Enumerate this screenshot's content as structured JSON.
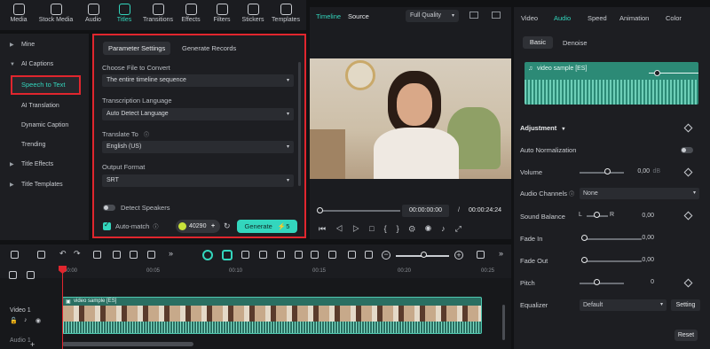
{
  "toolbar": {
    "items": [
      {
        "label": "Media",
        "icon": "media-icon"
      },
      {
        "label": "Stock Media",
        "icon": "stock-media-icon"
      },
      {
        "label": "Audio",
        "icon": "audio-icon"
      },
      {
        "label": "Titles",
        "icon": "titles-icon",
        "active": true
      },
      {
        "label": "Transitions",
        "icon": "transitions-icon"
      },
      {
        "label": "Effects",
        "icon": "effects-icon"
      },
      {
        "label": "Filters",
        "icon": "filters-icon"
      },
      {
        "label": "Stickers",
        "icon": "stickers-icon"
      },
      {
        "label": "Templates",
        "icon": "templates-icon"
      }
    ]
  },
  "sidebar": {
    "items": [
      {
        "label": "Mine"
      },
      {
        "label": "AI Captions"
      },
      {
        "label": "Speech to Text"
      },
      {
        "label": "AI Translation"
      },
      {
        "label": "Dynamic Caption"
      },
      {
        "label": "Trending"
      },
      {
        "label": "Title Effects"
      },
      {
        "label": "Title Templates"
      }
    ]
  },
  "caption_panel": {
    "tabs": [
      "Parameter Settings",
      "Generate Records"
    ],
    "choose_file_label": "Choose File to Convert",
    "choose_file_value": "The entire timeline sequence",
    "language_label": "Transcription Language",
    "language_value": "Auto Detect Language",
    "translate_label": "Translate To",
    "translate_value": "English (US)",
    "format_label": "Output Format",
    "format_value": "SRT",
    "detect_speakers_label": "Detect Speakers",
    "auto_match_label": "Auto-match",
    "credits": "40290",
    "generate_label": "Generate",
    "generate_cost": "5"
  },
  "player": {
    "tab_timeline": "Timeline",
    "tab_source": "Source",
    "quality": "Full Quality",
    "current_time": "00:00:00:00",
    "separator": "/",
    "total_time": "00:00:24:24"
  },
  "right_panel": {
    "tabs": [
      "Video",
      "Audio",
      "Speed",
      "Animation",
      "Color"
    ],
    "subtabs": [
      "Basic",
      "Denoise"
    ],
    "clip_name": "video sample [ES]",
    "adjustment_label": "Adjustment",
    "auto_normalization_label": "Auto Normalization",
    "volume_label": "Volume",
    "volume_value": "0,00",
    "volume_unit": "dB",
    "channels_label": "Audio Channels",
    "channels_value": "None",
    "balance_label": "Sound Balance",
    "balance_l": "L",
    "balance_r": "R",
    "balance_value": "0,00",
    "fade_in_label": "Fade In",
    "fade_in_value": "0,00",
    "fade_out_label": "Fade Out",
    "fade_out_value": "0,00",
    "pitch_label": "Pitch",
    "pitch_value": "0",
    "equalizer_label": "Equalizer",
    "equalizer_value": "Default",
    "setting_label": "Setting",
    "reset_label": "Reset"
  },
  "timeline": {
    "ruler_ticks": [
      "00:00",
      "00:05",
      "00:10",
      "00:15",
      "00:20",
      "00:25"
    ],
    "track_label": "Video 1",
    "track_label_2": "Audio 1",
    "clip_label": "video sample [ES]"
  },
  "colors": {
    "accent": "#33d6bd",
    "highlight_border": "#e0262e"
  }
}
